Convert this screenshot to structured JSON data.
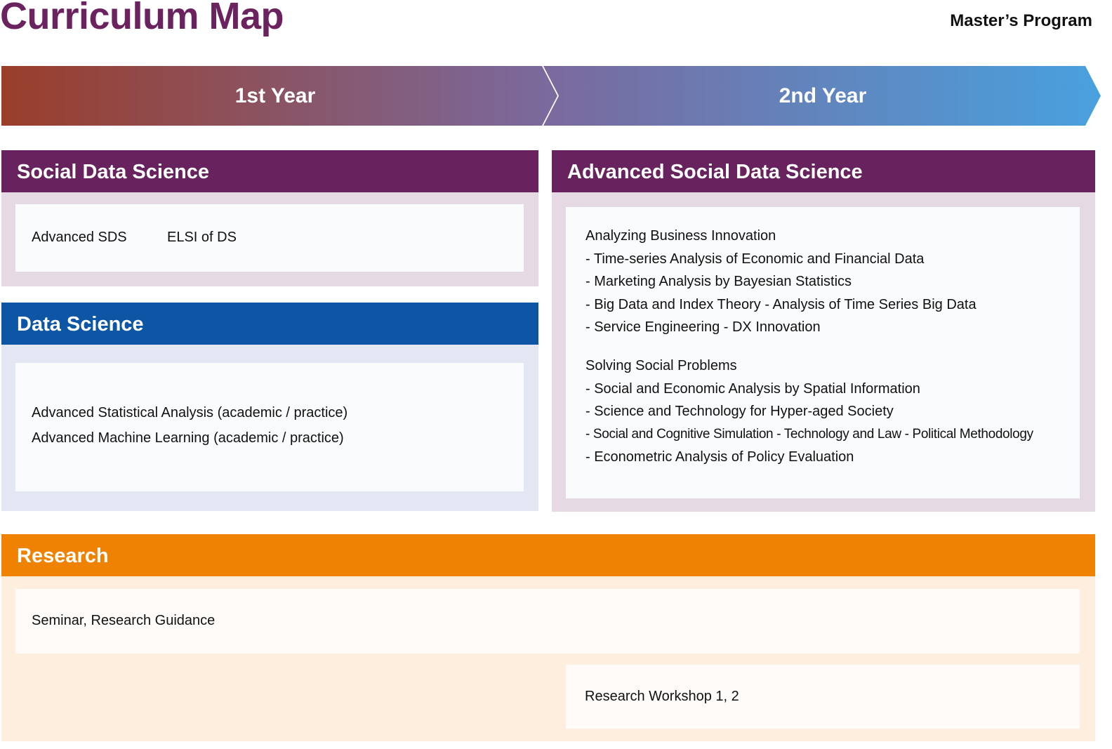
{
  "title": "Curriculum Map",
  "program": "Master’s Program",
  "years": [
    "1st Year",
    "2nd Year"
  ],
  "colors": {
    "title": "#6a235f",
    "purple_header": "#68235f",
    "blue_header": "#0d56a5",
    "orange_header": "#ef8200",
    "gradient_start": "#9a3e2a",
    "gradient_mid": "#7a6a9e",
    "gradient_end": "#48a1de"
  },
  "sections": {
    "social_data_science": {
      "heading": "Social Data Science",
      "courses": [
        "Advanced SDS",
        "ELSI of DS"
      ]
    },
    "data_science": {
      "heading": "Data Science",
      "courses": [
        "Advanced Statistical Analysis (academic / practice)",
        "Advanced Machine Learning (academic / practice)"
      ]
    },
    "advanced_social_data_science": {
      "heading": "Advanced Social Data Science",
      "groups": [
        {
          "title": "Analyzing Business Innovation",
          "items": [
            "- Time-series Analysis of Economic and Financial Data",
            "- Marketing Analysis by Bayesian Statistics",
            "- Big Data and Index Theory - Analysis of Time Series Big Data",
            "- Service Engineering - DX Innovation"
          ]
        },
        {
          "title": "Solving Social Problems",
          "items": [
            "- Social and Economic Analysis by Spatial Information",
            "- Science and Technology for Hyper-aged Society",
            "- Social and Cognitive Simulation - Technology and Law - Political Methodology",
            "- Econometric Analysis of Policy Evaluation"
          ]
        }
      ]
    },
    "research": {
      "heading": "Research",
      "courses": [
        "Seminar, Research Guidance",
        "Research Workshop 1, 2"
      ]
    }
  }
}
